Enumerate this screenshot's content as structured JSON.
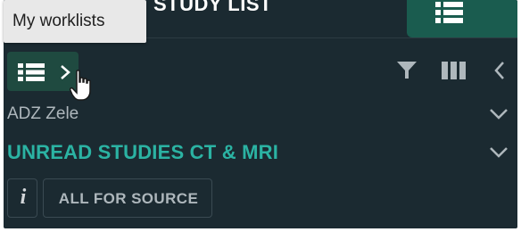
{
  "header": {
    "title": "STUDY LIST",
    "tab_icon": "list-icon",
    "tab_color": "#1a5c4f"
  },
  "tooltip": {
    "text": "My worklists"
  },
  "toolbar": {
    "worklists_button_icon": "list-icon",
    "worklists_chevron_icon": "chevron-right-icon",
    "filter_icon": "filter-icon",
    "columns_icon": "columns-icon",
    "collapse_icon": "chevron-left-icon"
  },
  "source": {
    "selected": "ADZ Zele"
  },
  "worklist": {
    "selected": "UNREAD STUDIES CT & MRI",
    "accent_color": "#2bb3a3"
  },
  "filters": {
    "info_glyph": "i",
    "chip_label": "ALL FOR SOURCE"
  },
  "colors": {
    "panel_background": "#1b2a31",
    "button_background": "#1f4a40",
    "tooltip_background": "#e8e8e8"
  }
}
